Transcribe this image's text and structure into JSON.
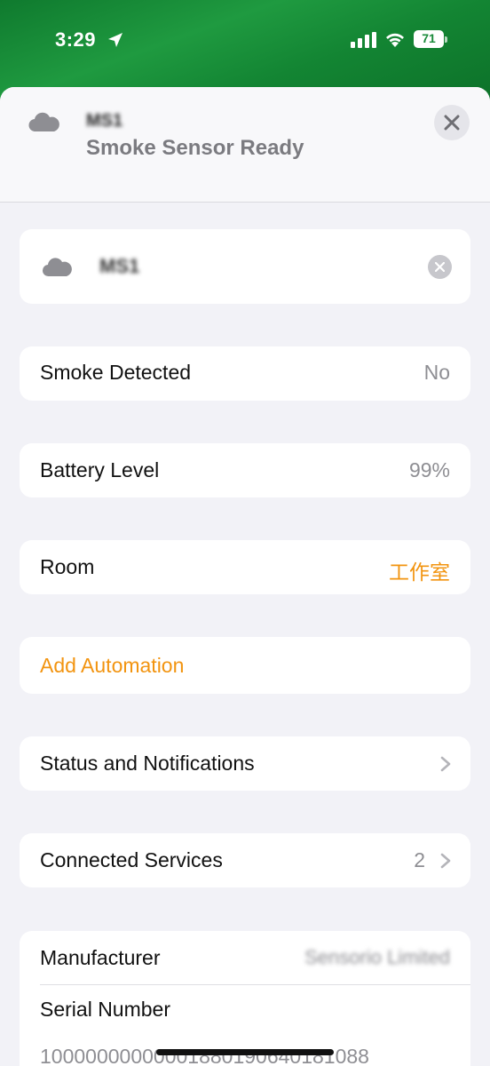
{
  "status_bar": {
    "time": "3:29",
    "battery_level": "71",
    "battery_percent": 71
  },
  "header": {
    "device_name": "MS1",
    "status": "Smoke Sensor Ready",
    "icon": "cloud-icon"
  },
  "name_field": {
    "value": "MS1",
    "icon": "cloud-icon"
  },
  "rows": {
    "smoke_detected": {
      "label": "Smoke Detected",
      "value": "No"
    },
    "battery_level": {
      "label": "Battery Level",
      "value": "99%"
    },
    "room": {
      "label": "Room",
      "value": "工作室"
    },
    "add_automation": {
      "label": "Add Automation"
    },
    "status_notifications": {
      "label": "Status and Notifications"
    },
    "connected_services": {
      "label": "Connected Services",
      "value": "2"
    }
  },
  "info": {
    "manufacturer_label": "Manufacturer",
    "manufacturer_value": "Sensorio Limited",
    "serial_label": "Serial Number",
    "serial_value": "10000000000001880190640181088"
  },
  "colors": {
    "accent": "#f29410",
    "wallpaper": "#1a8a3a",
    "secondary_text": "#8e8e93"
  }
}
